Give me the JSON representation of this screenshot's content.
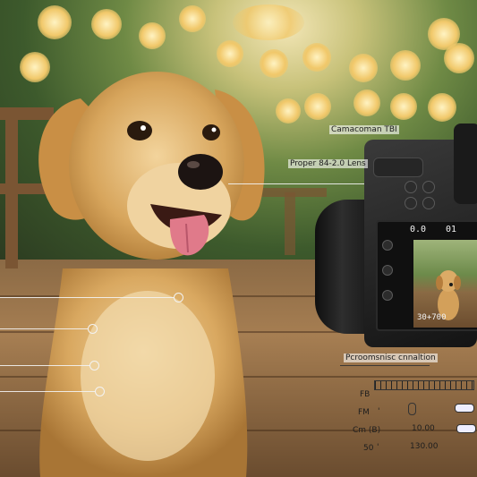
{
  "labels": {
    "camera_model": "Camacoman TBI",
    "lens": "Proper 84-2.0 Lens",
    "mode": "Pcroomsnisc cnnaltion"
  },
  "lcd": {
    "top_left": "0.0",
    "top_right": "01",
    "bottom": "30+700"
  },
  "readouts": {
    "r1_label": "FB",
    "r2_label": "FM",
    "r2_mark": "'",
    "r3_label": "Cm (B)",
    "r4_label": "50",
    "r4_mark": "'",
    "r3_value": "10.00",
    "r4_value": "130.00"
  },
  "colors": {
    "deck": "#a67e52",
    "foliage": "#3d5a2c",
    "fur": "#d9a860",
    "camera": "#1a1a1a"
  }
}
